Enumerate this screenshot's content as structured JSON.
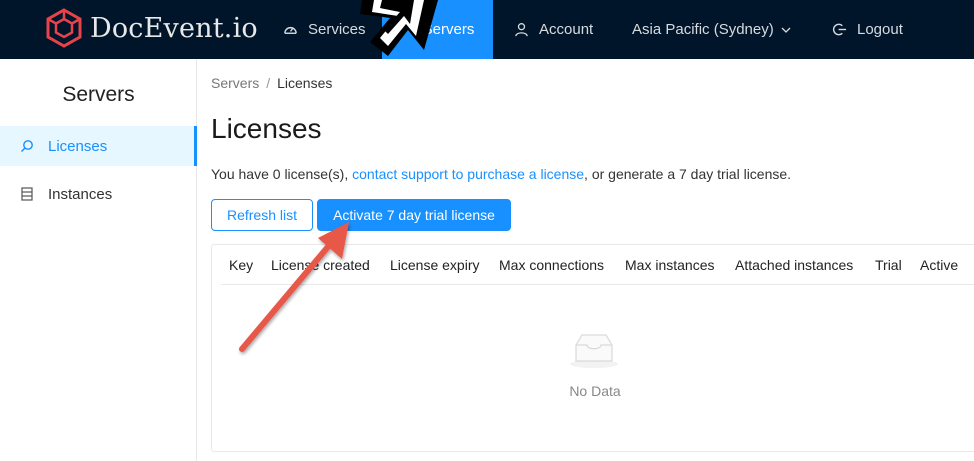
{
  "brand": {
    "name": "DocEvent.io",
    "logo_color": "#e8424b"
  },
  "nav": {
    "services": "Services",
    "servers": "Servers",
    "account": "Account",
    "region": "Asia Pacific (Sydney)",
    "logout": "Logout",
    "active_item": "servers"
  },
  "sidebar": {
    "title": "Servers",
    "items": [
      {
        "label": "Licenses",
        "icon": "search-icon",
        "active": true
      },
      {
        "label": "Instances",
        "icon": "server-icon",
        "active": false
      }
    ]
  },
  "breadcrumb": {
    "parent": "Servers",
    "separator": "/",
    "current": "Licenses"
  },
  "page": {
    "title": "Licenses",
    "intro_before": "You have 0 license(s), ",
    "intro_link": "contact support to purchase a license",
    "intro_after": ", or generate a 7 day trial license."
  },
  "buttons": {
    "refresh": "Refresh list",
    "activate": "Activate 7 day trial license"
  },
  "table": {
    "columns": [
      "Key",
      "License created",
      "License expiry",
      "Max connections",
      "Max instances",
      "Attached instances",
      "Trial",
      "Active"
    ],
    "empty_text": "No Data"
  },
  "colors": {
    "primary": "#1890ff",
    "topbar": "#001529",
    "annotation": "#e8584a"
  }
}
